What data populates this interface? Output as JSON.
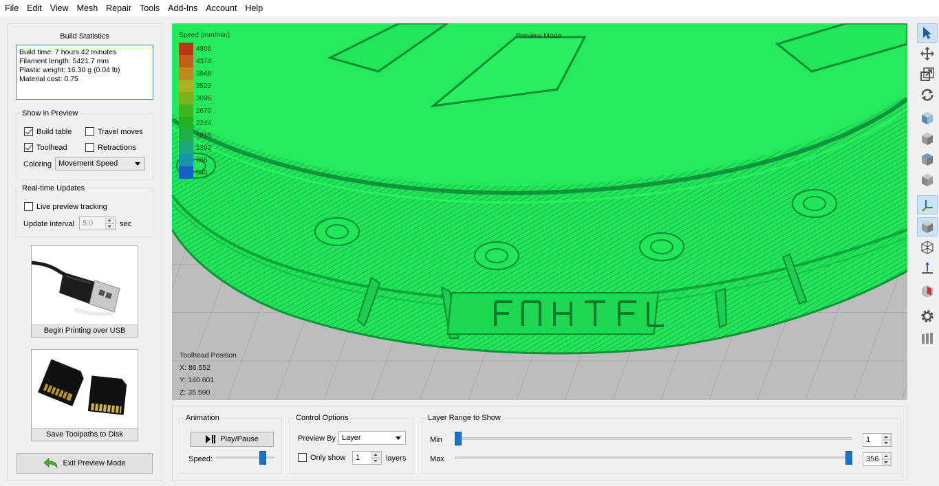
{
  "menu": [
    "File",
    "Edit",
    "View",
    "Mesh",
    "Repair",
    "Tools",
    "Add-Ins",
    "Account",
    "Help"
  ],
  "build_stats": {
    "title": "Build Statistics",
    "lines": [
      "Build time: 7 hours 42 minutes",
      "Filament length: 5421.7 mm",
      "Plastic weight: 16.30 g (0.04 lb)",
      "Material cost: 0.75"
    ]
  },
  "show_in_preview": {
    "title": "Show in Preview",
    "build_table": "Build table",
    "build_table_checked": true,
    "travel_moves": "Travel moves",
    "travel_moves_checked": false,
    "toolhead": "Toolhead",
    "toolhead_checked": true,
    "retractions": "Retractions",
    "retractions_checked": false,
    "coloring_label": "Coloring",
    "coloring_value": "Movement Speed"
  },
  "realtime": {
    "title": "Real-time Updates",
    "live_tracking": "Live preview tracking",
    "live_tracking_checked": false,
    "interval_label": "Update interval",
    "interval_value": "5.0",
    "interval_unit": "sec"
  },
  "usb_button": {
    "label": "Begin Printing over USB"
  },
  "sd_button": {
    "label": "Save Toolpaths to Disk"
  },
  "exit_button": {
    "label": "Exit Preview Mode"
  },
  "viewport": {
    "legend_title": "Speed (mm/min)",
    "mode_label": "Preview Mode",
    "legend": [
      {
        "value": "4800",
        "color": "#b83a14"
      },
      {
        "value": "4374",
        "color": "#c0601a"
      },
      {
        "value": "3948",
        "color": "#bf8b1e"
      },
      {
        "value": "3522",
        "color": "#a9b31f"
      },
      {
        "value": "3096",
        "color": "#78b41c"
      },
      {
        "value": "2670",
        "color": "#3fb41e"
      },
      {
        "value": "2244",
        "color": "#22b226"
      },
      {
        "value": "1818",
        "color": "#1fb04a"
      },
      {
        "value": "1392",
        "color": "#1ca77a"
      },
      {
        "value": "966",
        "color": "#1795aa"
      },
      {
        "value": "540",
        "color": "#1560c0"
      }
    ],
    "toolhead_title": "Toolhead Position",
    "toolhead_x": "X: 86.552",
    "toolhead_y": "Y: 140.601",
    "toolhead_z": "Z: 35.590"
  },
  "animation": {
    "title": "Animation",
    "play_label": "Play/Pause",
    "speed_label": "Speed:",
    "speed_level": 0.85
  },
  "control": {
    "title": "Control Options",
    "preview_by_label": "Preview By",
    "preview_by_value": "Layer",
    "only_show_label": "Only show",
    "only_show_checked": false,
    "only_show_value": "1",
    "layers_label": "layers"
  },
  "layer_range": {
    "title": "Layer Range to Show",
    "min_label": "Min",
    "max_label": "Max",
    "min_value": "1",
    "max_value": "356",
    "total_layers": 356
  },
  "toolbar": [
    "select-arrow-icon",
    "move-icon",
    "scale-icon",
    "rotate-icon",
    "view-front-icon",
    "view-top-icon",
    "view-side-icon",
    "view-iso-icon",
    "axes-icon",
    "solid-view-icon",
    "wireframe-view-icon",
    "normal-icon",
    "cut-icon",
    "settings-gear-icon",
    "columns-icon"
  ],
  "colors": {
    "accent": "#1a73c8",
    "print_green": "#22e65a",
    "bed_gray": "#bdbdbd"
  }
}
